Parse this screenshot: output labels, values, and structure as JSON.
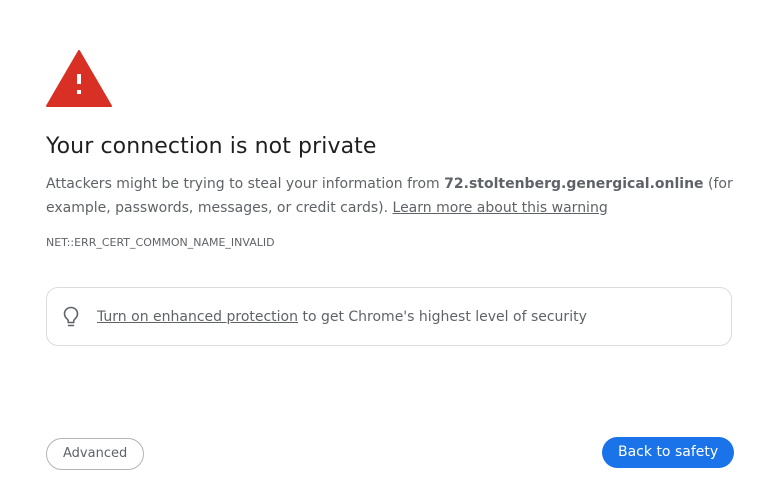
{
  "colors": {
    "warning_red": "#d93025",
    "primary_blue": "#1a73e8",
    "secondary_text": "#5f6368",
    "border": "#dadce0"
  },
  "warning": {
    "icon": "warning-triangle-icon",
    "title": "Your connection is not private"
  },
  "body": {
    "text_before_host": "Attackers might be trying to steal your information from ",
    "host": "72.stoltenberg.genergical.online",
    "text_after_host": " (for example, passwords, messages, or credit cards). ",
    "learn_more_link": "Learn more about this warning"
  },
  "error_code": "NET::ERR_CERT_COMMON_NAME_INVALID",
  "enhanced_protection": {
    "icon": "lightbulb-icon",
    "link": "Turn on enhanced protection",
    "text": " to get Chrome's highest level of security"
  },
  "buttons": {
    "advanced": "Advanced",
    "back_to_safety": "Back to safety"
  }
}
